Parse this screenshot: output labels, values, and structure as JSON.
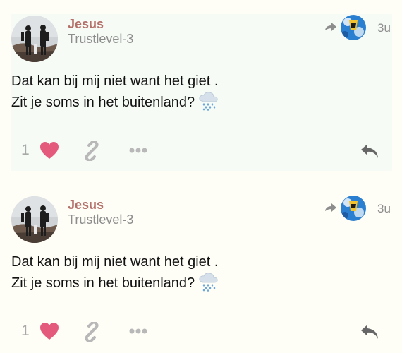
{
  "posts": [
    {
      "username": "Jesus",
      "user_title": "Trustlevel-3",
      "date": "3u",
      "body_lines": [
        "Dat kan bij mij niet want het giet .",
        "Zit je soms in het buitenland?"
      ],
      "like_count": "1",
      "highlighted": true
    },
    {
      "username": "Jesus",
      "user_title": "Trustlevel-3",
      "date": "3u",
      "body_lines": [
        "Dat kan bij mij niet want het giet .",
        "Zit je soms in het buitenland?"
      ],
      "like_count": "1",
      "highlighted": false
    }
  ],
  "icons": {
    "reply_to": "reply-arrow-icon",
    "rain": "cloud-with-rain-icon",
    "like": "heart-icon",
    "link": "link-icon",
    "more": "ellipsis-icon",
    "reply": "reply-icon"
  },
  "colors": {
    "username": "#b5706a",
    "muted": "#8d8d8d",
    "heart": "#e45a7d",
    "highlight_bg": "#f6fbf6",
    "page_bg": "#fefdf6"
  }
}
